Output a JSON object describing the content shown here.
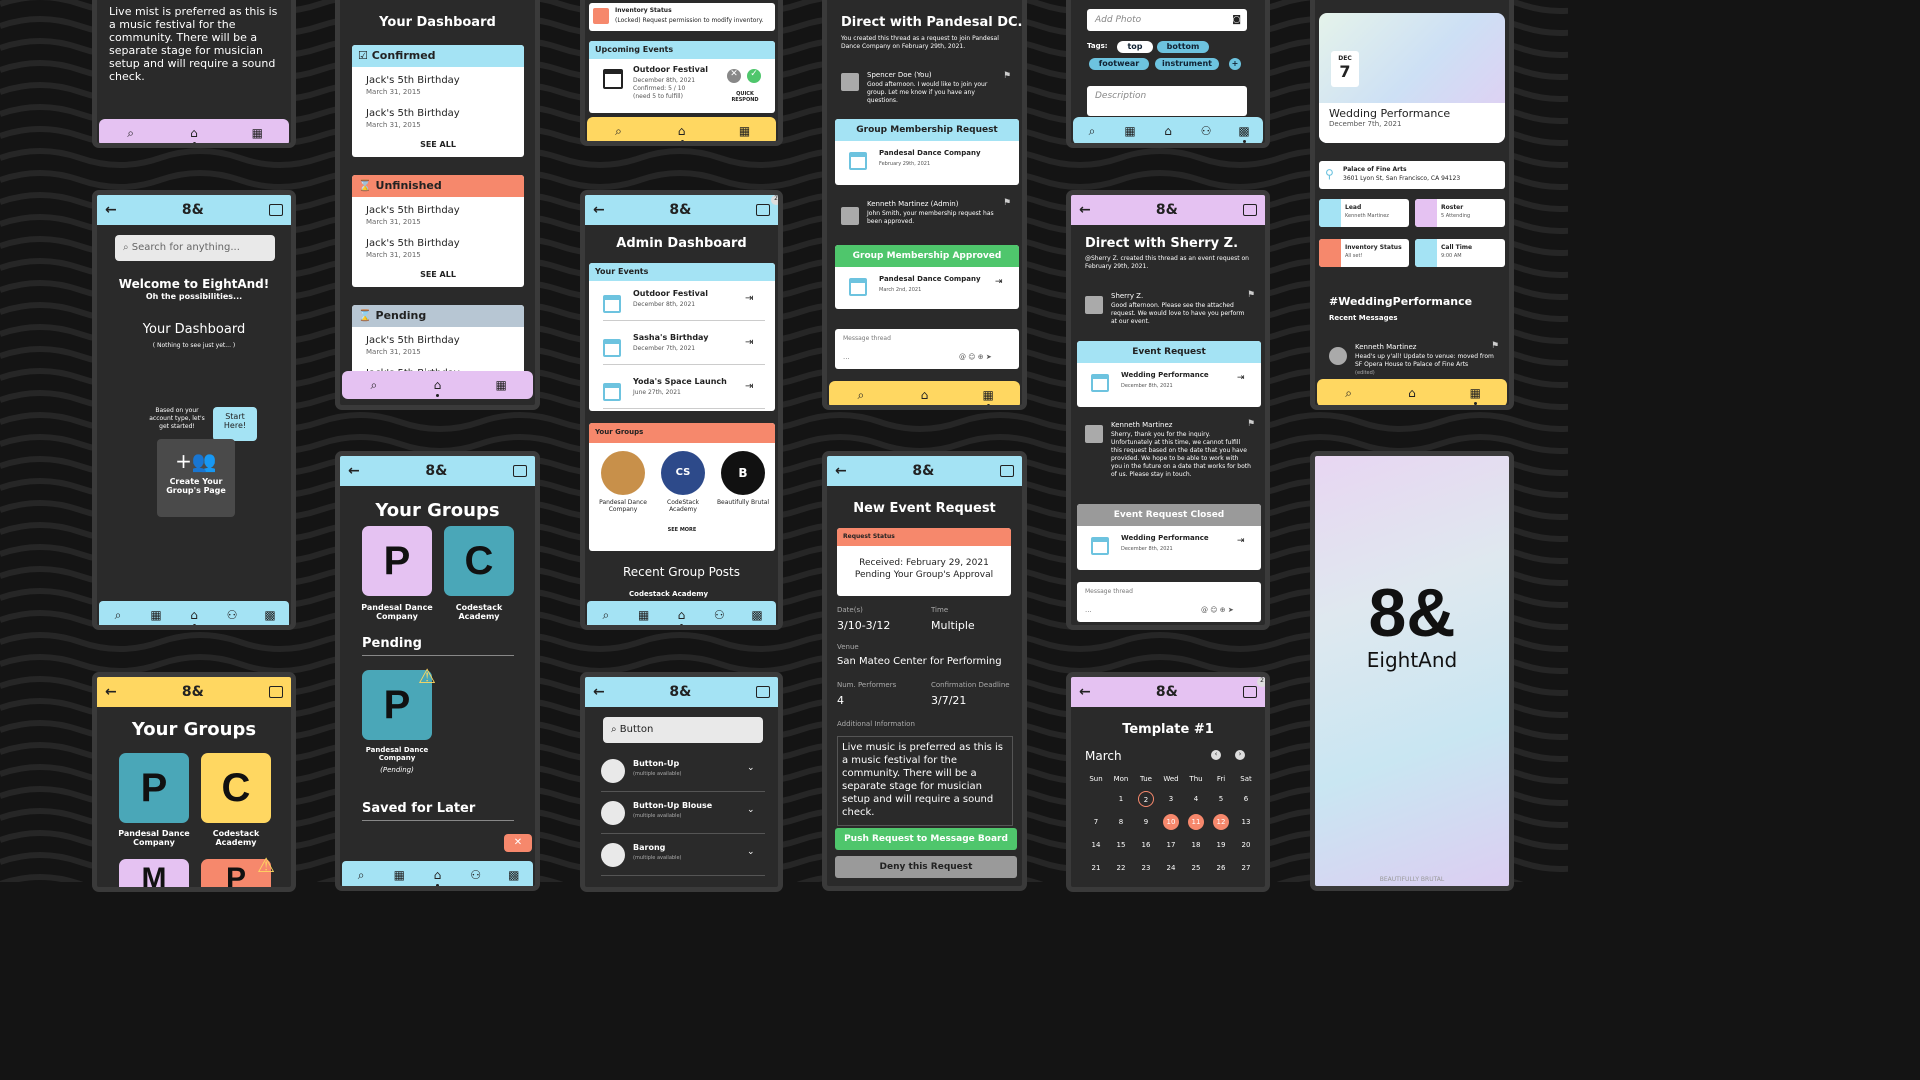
{
  "colors": {
    "cyan": "#a4e3f4",
    "pink": "#e5c2f2",
    "yellow": "#ffd761",
    "green": "#4fc66c",
    "orange": "#f6886c",
    "blue_gray": "#b7c6d3",
    "teal": "#4aa7b8",
    "dark": "#2a2a2a"
  },
  "app": {
    "logo_mark": "8&",
    "name": "EightAnd",
    "tagline": "BEAUTIFULLY BRUTAL"
  },
  "icons": [
    "back-arrow-icon",
    "inbox-icon",
    "search-icon",
    "home-icon",
    "calendar-icon",
    "people-icon",
    "qr-icon",
    "flag-icon",
    "warning-icon",
    "hourglass-icon",
    "enter-icon",
    "chevron-down-icon",
    "camera-icon",
    "location-pin-icon"
  ],
  "p1": {
    "text": "Live mist is preferred as this is a music festival for the community. There will be a separate stage for musician setup and will require a sound check."
  },
  "p2": {
    "search_placeholder": "Search for anything...",
    "welcome": "Welcome to EightAnd!",
    "subtitle": "Oh the possibilities...",
    "dash": "Your Dashboard",
    "nothing": "( Nothing to see just yet... )",
    "hint": "Based on your account type, let's get started!",
    "bubble": "Start Here!",
    "create": "Create Your Group's Page"
  },
  "p3": {
    "title": "Your Groups",
    "groups": [
      {
        "letter": "P",
        "name": "Pandesal Dance Company"
      },
      {
        "letter": "C",
        "name": "Codestack Academy"
      }
    ],
    "more": [
      "M",
      "P"
    ]
  },
  "p4": {
    "title": "Your Dashboard",
    "sections": [
      {
        "label": "Confirmed",
        "items": [
          {
            "name": "Jack's 5th Birthday",
            "date": "March 31, 2015"
          },
          {
            "name": "Jack's 5th Birthday",
            "date": "March 31, 2015"
          }
        ],
        "see_all": "SEE ALL"
      },
      {
        "label": "Unfinished",
        "items": [
          {
            "name": "Jack's 5th Birthday",
            "date": "March 31, 2015"
          },
          {
            "name": "Jack's 5th Birthday",
            "date": "March 31, 2015"
          }
        ],
        "see_all": "SEE ALL"
      },
      {
        "label": "Pending",
        "items": [
          {
            "name": "Jack's 5th Birthday",
            "date": "March 31, 2015"
          },
          {
            "name": "Jack's 5th Birthday",
            "date": ""
          }
        ]
      }
    ]
  },
  "p5": {
    "title": "Your Groups",
    "groups": [
      {
        "letter": "P",
        "name": "Pandesal Dance Company"
      },
      {
        "letter": "C",
        "name": "Codestack Academy"
      }
    ],
    "pending": "Pending",
    "pending_group": {
      "letter": "P",
      "name": "Pandesal Dance Company",
      "status": "(Pending)"
    },
    "saved": "Saved for Later"
  },
  "p6": {
    "inventory_title": "Inventory Status",
    "inventory_text": "(Locked) Request permission to modify inventory.",
    "upcoming": "Upcoming Events",
    "event": {
      "name": "Outdoor Festival",
      "date": "December 8th, 2021",
      "confirmed": "Confirmed:  5 / 10",
      "need": "(need 5 to fulfill)"
    },
    "quick": "QUICK RESPOND"
  },
  "p7": {
    "title": "Admin Dashboard",
    "your_events": "Your Events",
    "events": [
      {
        "name": "Outdoor Festival",
        "date": "December 8th, 2021"
      },
      {
        "name": "Sasha's Birthday",
        "date": "December 7th, 2021"
      },
      {
        "name": "Yoda's Space Launch",
        "date": "June 27th, 2021"
      }
    ],
    "your_groups": "Your Groups",
    "groups": [
      {
        "name": "Pandesal Dance Company"
      },
      {
        "name": "CodeStack Academy"
      },
      {
        "name": "Beautifully Brutal"
      }
    ],
    "see_more": "SEE MORE",
    "recent": "Recent Group Posts",
    "post": "Codestack Academy",
    "badge": "2"
  },
  "p8": {
    "search_value": "Button",
    "items": [
      {
        "name": "Button-Up",
        "note": "(multiple available)"
      },
      {
        "name": "Button-Up Blouse",
        "note": "(multiple available)"
      },
      {
        "name": "Barong",
        "note": "(multiple available)"
      }
    ]
  },
  "p9": {
    "title": "Direct with Pandesal DC.",
    "intro": "You created this thread as a request to join Pandesal Dance Company on February 29th, 2021.",
    "msg1_author": "Spencer Doe (You)",
    "msg1": "Good afternoon. I would like to join your group. Let me know if you have any questions.",
    "req_title": "Group Membership Request",
    "req_name": "Pandesal Dance Company",
    "req_date": "February 29th, 2021",
    "msg2_author": "Kenneth Martinez (Admin)",
    "msg2": "John Smith, your membership request has been approved.",
    "ok_title": "Group Membership Approved",
    "ok_name": "Pandesal Dance Company",
    "ok_date": "March 2nd, 2021",
    "thread": "Message thread",
    "ellipsis": "..."
  },
  "p10": {
    "title": "New Event Request",
    "status_label": "Request Status",
    "received": "Received: February 29, 2021",
    "pending": "Pending Your Group's Approval",
    "dates_l": "Date(s)",
    "dates": "3/10-3/12",
    "time_l": "Time",
    "time": "Multiple",
    "venue_l": "Venue",
    "venue": "San Mateo Center for Performing",
    "num_l": "Num. Performers",
    "num": "4",
    "conf_l": "Confirmation Deadline",
    "conf": "3/7/21",
    "add_l": "Additional Information",
    "add": "Live music is preferred as this is a music festival for the community. There will be a separate stage for musician setup and will require a sound check.",
    "push": "Push Request to Message Board",
    "deny": "Deny this Request"
  },
  "p11": {
    "add_photo": "Add Photo",
    "tags_l": "Tags:",
    "tags": [
      "top",
      "bottom",
      "footwear",
      "instrument"
    ],
    "plus": "+",
    "desc": "Description"
  },
  "p12": {
    "title": "Direct with Sherry Z.",
    "intro": "@Sherry Z. created this thread as an event request on February 29th, 2021.",
    "m1_author": "Sherry Z.",
    "m1": "Good afternoon. Please see the attached request. We would love to have you perform at our event.",
    "req": "Event Request",
    "ev": "Wedding Performance",
    "ev_date": "December 8th, 2021",
    "m2_author": "Kenneth Martinez",
    "m2": "Sherry, thank you for the inquiry. Unfortunately at this time, we cannot fulfill this request based on the date that you have provided. We hope to be able to work with you in the future on a date that works for both of us. Please stay in touch.",
    "closed": "Event Request Closed",
    "thread": "Message thread",
    "ellipsis": "..."
  },
  "p13": {
    "title": "Template #1",
    "month": "March",
    "days": [
      "Sun",
      "Mon",
      "Tue",
      "Wed",
      "Thu",
      "Fri",
      "Sat"
    ],
    "weeks": [
      [
        "",
        "1",
        "2",
        "3",
        "4",
        "5",
        "6"
      ],
      [
        "7",
        "8",
        "9",
        "10",
        "11",
        "12",
        "13"
      ],
      [
        "14",
        "15",
        "16",
        "17",
        "18",
        "19",
        "20"
      ],
      [
        "21",
        "22",
        "23",
        "24",
        "25",
        "26",
        "27"
      ]
    ],
    "badge": "2"
  },
  "p14": {
    "month": "DEC",
    "day": "7",
    "event": "Wedding Performance",
    "date": "December 7th, 2021",
    "venue": "Palace of Fine Arts",
    "address": "3601 Lyon St, San Francisco, CA 94123",
    "tiles": [
      {
        "t": "Lead",
        "s": "Kenneth Martinez"
      },
      {
        "t": "Roster",
        "s": "5 Attending"
      },
      {
        "t": "Inventory Status",
        "s": "All set!"
      },
      {
        "t": "Call Time",
        "s": "9:00 AM"
      }
    ],
    "hashtag": "#WeddingPerformance",
    "recent": "Recent Messages",
    "author": "Kenneth Martinez",
    "msg": "Head's up y'all! Update to venue: moved from SF Opera House to Palace of Fine Arts",
    "edited": "(edited)"
  }
}
